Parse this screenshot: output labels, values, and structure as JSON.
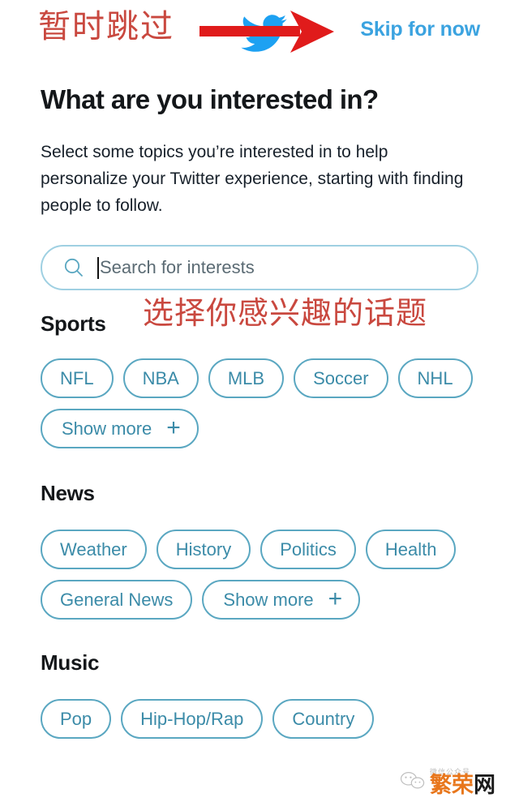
{
  "header": {
    "annotation_cn": "暂时跳过",
    "skip_label": "Skip for now",
    "bird_icon": "twitter-bird-icon",
    "arrow_icon": "red-arrow-icon",
    "skip_color": "#3ba3e0",
    "annotation_color": "#c9483f",
    "arrow_color": "#e01b1b",
    "bird_color": "#1DA1F2"
  },
  "main": {
    "title": "What are you interested in?",
    "description": "Select some topics you’re interested in to help personalize your Twitter experience, starting with finding people to follow."
  },
  "search": {
    "icon": "search-icon",
    "placeholder": "Search for interests",
    "value": ""
  },
  "annotations": {
    "topics_cn": "选择你感兴趣的话题"
  },
  "sections": [
    {
      "title": "Sports",
      "chips": [
        "NFL",
        "NBA",
        "MLB",
        "Soccer",
        "NHL"
      ],
      "show_more": "Show more"
    },
    {
      "title": "News",
      "chips": [
        "Weather",
        "History",
        "Politics",
        "Health",
        "General News"
      ],
      "show_more": "Show more"
    },
    {
      "title": "Music",
      "chips": [
        "Pop",
        "Hip-Hop/Rap",
        "Country"
      ],
      "show_more": ""
    }
  ],
  "chip_style": {
    "border_color": "#5aa7c1",
    "text_color": "#3b8ba8"
  },
  "watermark": {
    "faint_text": "微信公众号",
    "text_orange": "繁荣",
    "text_black": "网",
    "logo": "wechat-logo-icon"
  }
}
